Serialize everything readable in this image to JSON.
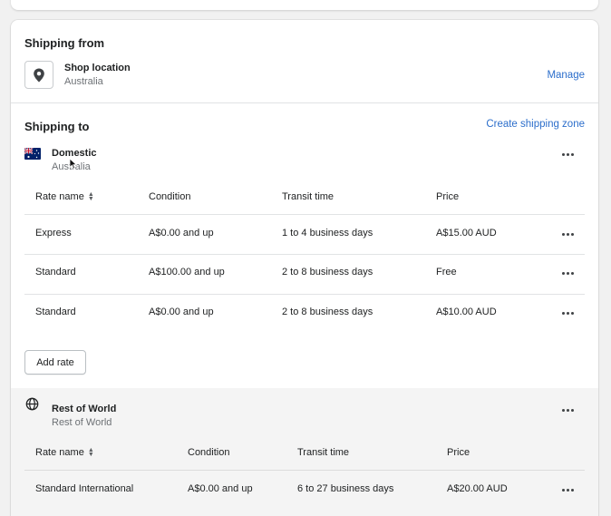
{
  "shipping_from": {
    "title": "Shipping from",
    "location_name": "Shop location",
    "location_country": "Australia",
    "manage_label": "Manage"
  },
  "shipping_to": {
    "title": "Shipping to",
    "create_zone_label": "Create shipping zone"
  },
  "domestic": {
    "name": "Domestic",
    "country": "Australia",
    "headers": {
      "rate_name": "Rate name",
      "condition": "Condition",
      "transit": "Transit time",
      "price": "Price"
    },
    "rows": [
      {
        "name": "Express",
        "condition": "A$0.00 and up",
        "transit": "1 to 4 business days",
        "price": "A$15.00 AUD"
      },
      {
        "name": "Standard",
        "condition": "A$100.00 and up",
        "transit": "2 to 8 business days",
        "price": "Free"
      },
      {
        "name": "Standard",
        "condition": "A$0.00 and up",
        "transit": "2 to 8 business days",
        "price": "A$10.00 AUD"
      }
    ],
    "add_rate_label": "Add rate"
  },
  "rest_of_world": {
    "name": "Rest of World",
    "region": "Rest of World",
    "headers": {
      "rate_name": "Rate name",
      "condition": "Condition",
      "transit": "Transit time",
      "price": "Price"
    },
    "rows": [
      {
        "name": "Standard International",
        "condition": "A$0.00 and up",
        "transit": "6 to 27 business days",
        "price": "A$20.00 AUD"
      }
    ]
  },
  "colors": {
    "link": "#2c6ecb",
    "text": "#202223",
    "muted": "#6d7175",
    "divider": "#e1e3e5"
  },
  "icons": [
    "location-pin-icon",
    "australia-flag-icon",
    "globe-icon",
    "more-actions-icon",
    "sort-icon",
    "mouse-cursor-icon"
  ]
}
